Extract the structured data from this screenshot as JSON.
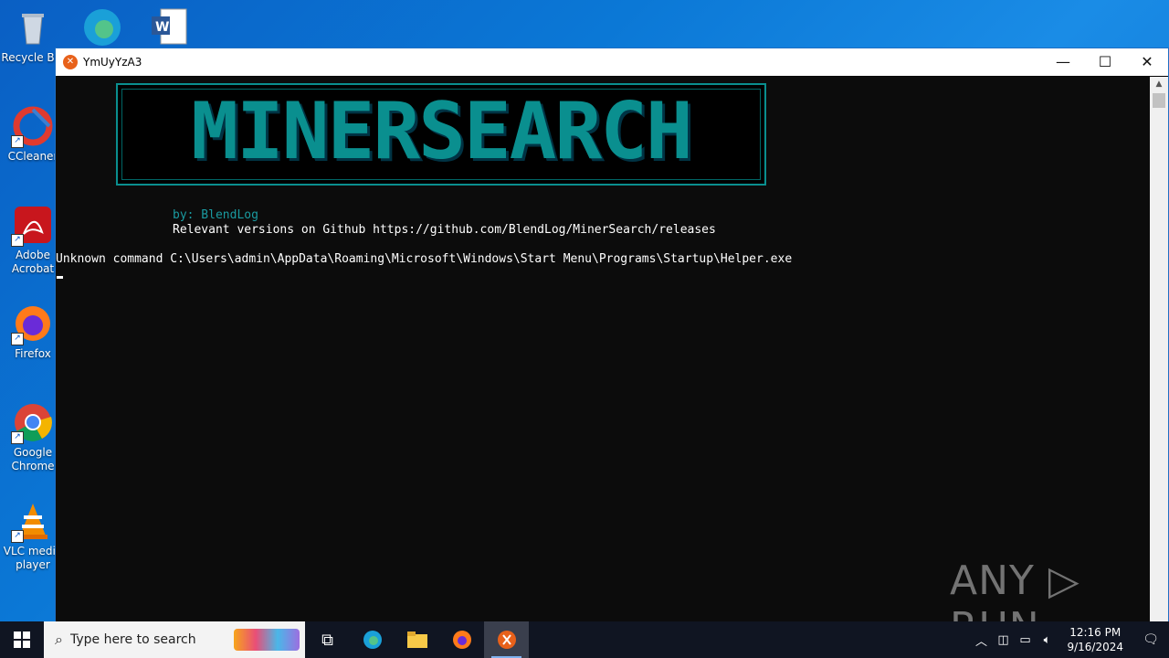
{
  "desktop": {
    "icons": [
      {
        "label": "Recycle Bin",
        "name": "recycle-bin"
      },
      {
        "label": "CCleaner",
        "name": "ccleaner"
      },
      {
        "label": "Adobe Acrobat",
        "name": "adobe-acrobat"
      },
      {
        "label": "Firefox",
        "name": "firefox"
      },
      {
        "label": "Google Chrome",
        "name": "google-chrome"
      },
      {
        "label": "VLC media player",
        "name": "vlc"
      }
    ]
  },
  "window": {
    "title": "YmUyYzA3",
    "controls": {
      "minimize": "—",
      "maximize": "☐",
      "close": "✕"
    }
  },
  "console": {
    "banner": "MINERSEARCH",
    "author": "by: BlendLog",
    "releases": "Relevant versions on Github https://github.com/BlendLog/MinerSearch/releases",
    "error": "Unknown command C:\\Users\\admin\\AppData\\Roaming\\Microsoft\\Windows\\Start Menu\\Programs\\Startup\\Helper.exe"
  },
  "watermark": "ANY ▷ RUN",
  "taskbar": {
    "search_placeholder": "Type here to search",
    "clock_time": "12:16 PM",
    "clock_date": "9/16/2024"
  }
}
